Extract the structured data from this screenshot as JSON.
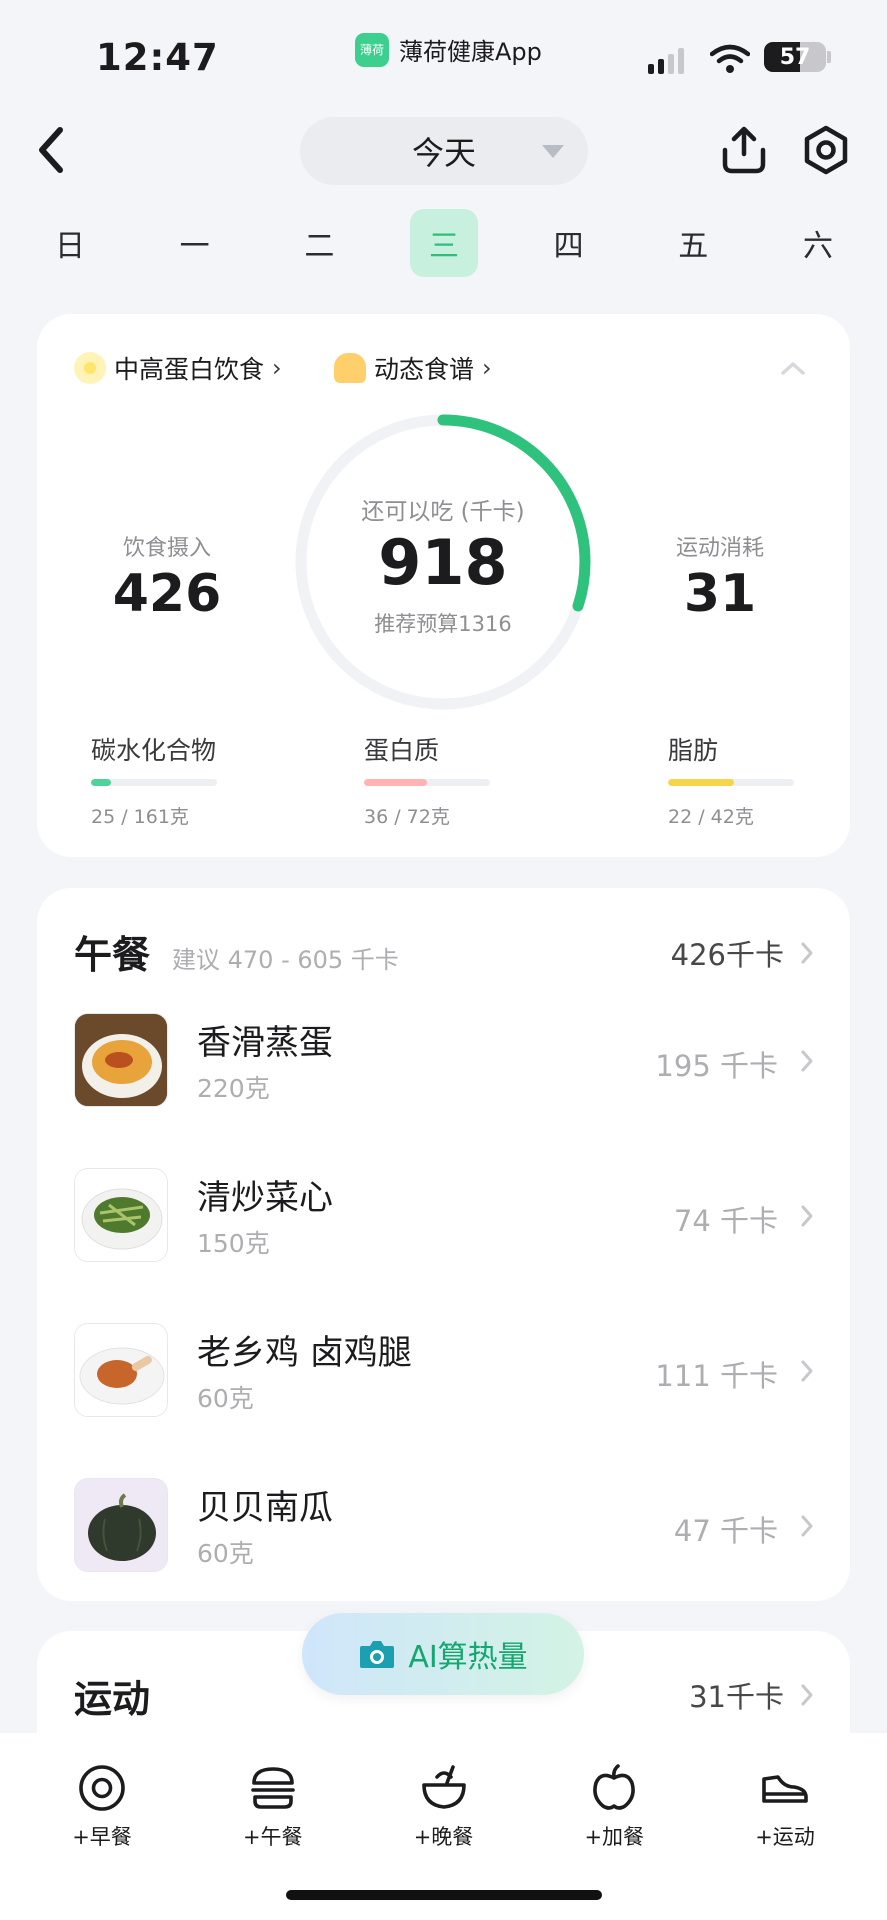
{
  "status_bar": {
    "time": "12:47",
    "app_badge": "薄荷",
    "app_name": "薄荷健康App",
    "battery": "57"
  },
  "header": {
    "date_label": "今天"
  },
  "week": {
    "days": [
      "日",
      "一",
      "二",
      "三",
      "四",
      "五",
      "六"
    ],
    "selected_index": 3
  },
  "summary": {
    "tag_diet": "中高蛋白饮食",
    "tag_recipe": "动态食谱",
    "intake_label": "饮食摄入",
    "intake_value": "426",
    "remaining_label": "还可以吃 (千卡)",
    "remaining_value": "918",
    "budget_label": "推荐预算1316",
    "burn_label": "运动消耗",
    "burn_value": "31",
    "ring_progress": 0.3,
    "macros": [
      {
        "name": "碳水化合物",
        "amount": "25 / 161克",
        "fraction": 0.155,
        "color": "#4fd39a"
      },
      {
        "name": "蛋白质",
        "amount": "36 / 72克",
        "fraction": 0.5,
        "color": "#ffb3b3"
      },
      {
        "name": "脂肪",
        "amount": "22 / 42克",
        "fraction": 0.52,
        "color": "#f7d54a"
      }
    ]
  },
  "lunch": {
    "title": "午餐",
    "hint": "建议 470 - 605 千卡",
    "total": "426千卡",
    "items": [
      {
        "name": "香滑蒸蛋",
        "amount": "220克",
        "kcal": "195 千卡"
      },
      {
        "name": "清炒菜心",
        "amount": "150克",
        "kcal": "74 千卡"
      },
      {
        "name": "老乡鸡 卤鸡腿",
        "amount": "60克",
        "kcal": "111 千卡"
      },
      {
        "name": "贝贝南瓜",
        "amount": "60克",
        "kcal": "47 千卡"
      }
    ]
  },
  "exercise": {
    "title": "运动",
    "total": "31千卡"
  },
  "ai_button": {
    "label": "AI算热量"
  },
  "bottom_tabs": [
    {
      "label": "+早餐",
      "icon": "egg-icon"
    },
    {
      "label": "+午餐",
      "icon": "burger-icon"
    },
    {
      "label": "+晚餐",
      "icon": "bowl-icon"
    },
    {
      "label": "+加餐",
      "icon": "apple-icon"
    },
    {
      "label": "+运动",
      "icon": "shoe-icon"
    }
  ],
  "colors": {
    "accent": "#2fc27d",
    "ring_track": "#f1f2f5"
  }
}
